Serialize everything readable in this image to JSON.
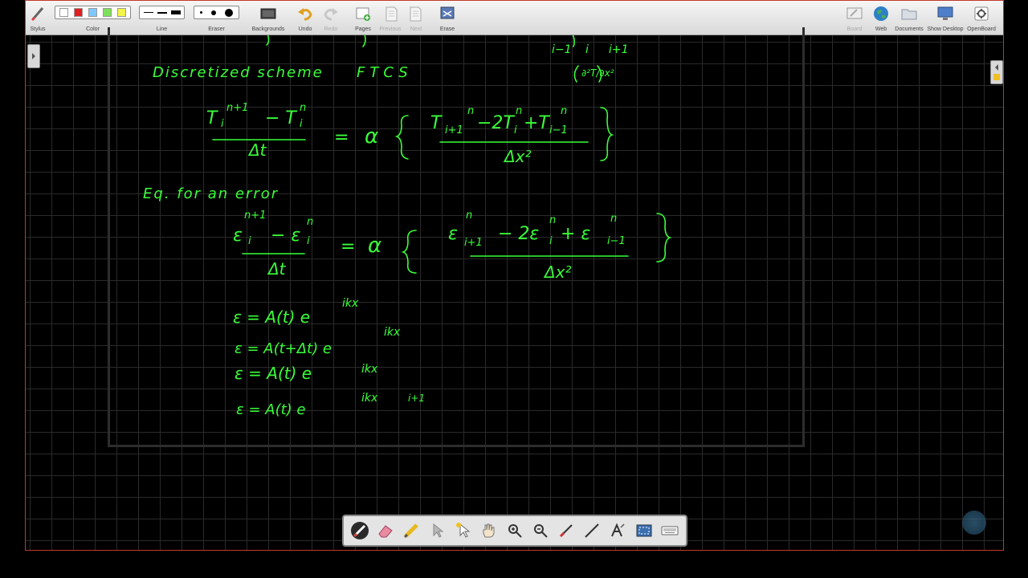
{
  "toolbar": {
    "stylus_label": "Stylus",
    "color_label": "Color",
    "line_label": "Line",
    "eraser_label": "Eraser",
    "backgrounds_label": "Backgrounds",
    "undo_label": "Undo",
    "redo_label": "Redo",
    "pages_label": "Pages",
    "previous_label": "Previous",
    "next_label": "Next",
    "erase_label": "Erase",
    "board_label": "Board",
    "web_label": "Web",
    "documents_label": "Documents",
    "show_desktop_label": "Show Desktop",
    "openboard_label": "OpenBoard",
    "colors": [
      "#ffffff",
      "#e02020",
      "#7fc7ff",
      "#7ee05a",
      "#f4f44a"
    ],
    "disabled_color": "#aaaaaa"
  },
  "ink": {
    "color": "#39ff39",
    "heading_partial": "∂²T/∂x²",
    "discretized": "Discretized scheme",
    "ftcs": "FTCS",
    "eq_label": "Eq. for an error",
    "alpha": "α",
    "dx2": "Δx²",
    "dt": "Δt",
    "fraction_den_top": "Δt",
    "eq3": "ε = A(t) e",
    "eq3_sup": "ikx",
    "eq4": "ε    = A(t+Δt) e",
    "eq4_sup": "ikx",
    "eq5": "ε   = A(t) e",
    "eq5_sup": "ikx",
    "eq6": "ε    = A(t) e",
    "eq6_sup": "ikx",
    "eq6_sup_tail": "i+1"
  },
  "bottom_tools": [
    "pen-icon",
    "eraser-icon",
    "marker-icon",
    "pointer-icon",
    "laser-icon",
    "hand-icon",
    "zoom-in-icon",
    "zoom-out-icon",
    "line-icon",
    "ruler-icon",
    "text-icon",
    "capture-icon",
    "keyboard-icon"
  ]
}
